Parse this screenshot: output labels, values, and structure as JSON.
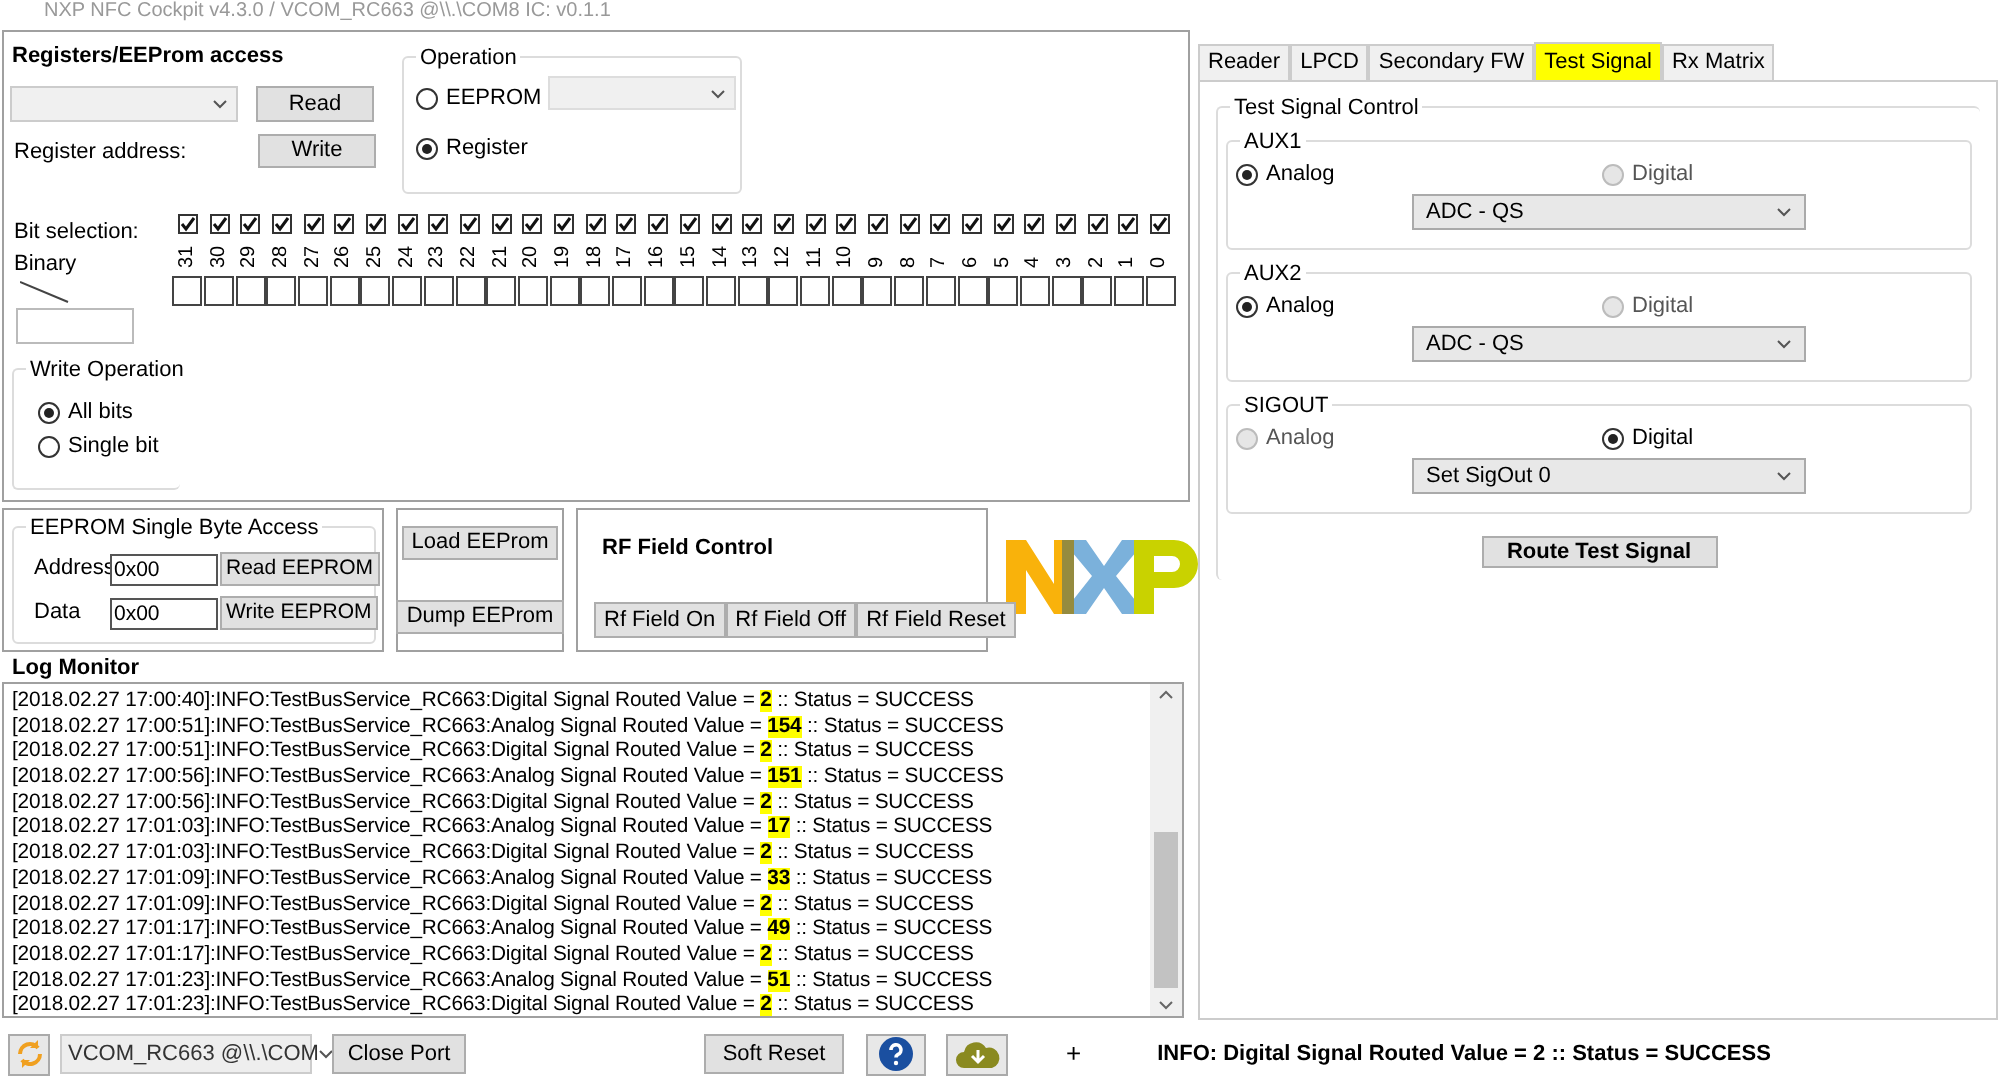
{
  "window": {
    "title": "NXP NFC Cockpit v4.3.0 / VCOM_RC663 @\\\\.\\COM8 IC: v0.1.1"
  },
  "registers": {
    "title": "Registers/EEProm access",
    "read_button": "Read",
    "write_button": "Write",
    "address_label": "Register address:",
    "operation": {
      "title": "Operation",
      "options": [
        {
          "label": "EEPROM",
          "selected": false
        },
        {
          "label": "Register",
          "selected": true
        }
      ]
    },
    "bit_selection_label": "Bit selection:",
    "binary_label": "Binary",
    "bits": [
      {
        "label": "31",
        "checked": true
      },
      {
        "label": "30",
        "checked": true
      },
      {
        "label": "29",
        "checked": true
      },
      {
        "label": "28",
        "checked": true
      },
      {
        "label": "27",
        "checked": true
      },
      {
        "label": "26",
        "checked": true
      },
      {
        "label": "25",
        "checked": true
      },
      {
        "label": "24",
        "checked": true
      },
      {
        "label": "23",
        "checked": true
      },
      {
        "label": "22",
        "checked": true
      },
      {
        "label": "21",
        "checked": true
      },
      {
        "label": "20",
        "checked": true
      },
      {
        "label": "19",
        "checked": true
      },
      {
        "label": "18",
        "checked": true
      },
      {
        "label": "17",
        "checked": true
      },
      {
        "label": "16",
        "checked": true
      },
      {
        "label": "15",
        "checked": true
      },
      {
        "label": "14",
        "checked": true
      },
      {
        "label": "13",
        "checked": true
      },
      {
        "label": "12",
        "checked": true
      },
      {
        "label": "11",
        "checked": true
      },
      {
        "label": "10",
        "checked": true
      },
      {
        "label": "9",
        "checked": true
      },
      {
        "label": "8",
        "checked": true
      },
      {
        "label": "7",
        "checked": true
      },
      {
        "label": "6",
        "checked": true
      },
      {
        "label": "5",
        "checked": true
      },
      {
        "label": "4",
        "checked": true
      },
      {
        "label": "3",
        "checked": true
      },
      {
        "label": "2",
        "checked": true
      },
      {
        "label": "1",
        "checked": true
      },
      {
        "label": "0",
        "checked": true
      }
    ],
    "write_operation": {
      "title": "Write Operation",
      "options": [
        {
          "label": "All bits",
          "selected": true
        },
        {
          "label": "Single bit",
          "selected": false
        }
      ]
    }
  },
  "eeprom_single": {
    "title": "EEPROM Single Byte Access",
    "address_label": "Address",
    "address_value": "0x00",
    "read_button": "Read EEPROM",
    "data_label": "Data",
    "data_value": "0x00",
    "write_button": "Write EEPROM"
  },
  "eeprom_buttons": [
    "Load EEProm",
    "Dump EEProm"
  ],
  "rf_field": {
    "title": "RF Field Control",
    "buttons": [
      "Rf Field On",
      "Rf Field Off",
      "Rf Field Reset"
    ]
  },
  "log": {
    "title": "Log Monitor",
    "lines": [
      {
        "before": "[2018.02.27 17:00:40]:INFO:TestBusService_RC663:Digital Signal Routed Value = ",
        "value": "2",
        "after": " :: Status = SUCCESS",
        "highlighted": true
      },
      {
        "before": "[2018.02.27 17:00:51]:INFO:TestBusService_RC663:Analog Signal Routed Value = ",
        "value": "154",
        "after": " :: Status = SUCCESS",
        "highlighted": true
      },
      {
        "before": "[2018.02.27 17:00:51]:INFO:TestBusService_RC663:Digital Signal Routed Value = ",
        "value": "2",
        "after": " :: Status = SUCCESS",
        "highlighted": true
      },
      {
        "before": "[2018.02.27 17:00:56]:INFO:TestBusService_RC663:Analog Signal Routed Value = ",
        "value": "151",
        "after": " :: Status = SUCCESS",
        "highlighted": true
      },
      {
        "before": "[2018.02.27 17:00:56]:INFO:TestBusService_RC663:Digital Signal Routed Value = ",
        "value": "2",
        "after": " :: Status = SUCCESS",
        "highlighted": true
      },
      {
        "before": "[2018.02.27 17:01:03]:INFO:TestBusService_RC663:Analog Signal Routed Value = ",
        "value": "17",
        "after": " :: Status = SUCCESS",
        "highlighted": true
      },
      {
        "before": "[2018.02.27 17:01:03]:INFO:TestBusService_RC663:Digital Signal Routed Value = ",
        "value": "2",
        "after": " :: Status = SUCCESS",
        "highlighted": true
      },
      {
        "before": "[2018.02.27 17:01:09]:INFO:TestBusService_RC663:Analog Signal Routed Value = ",
        "value": "33",
        "after": " :: Status = SUCCESS",
        "highlighted": true
      },
      {
        "before": "[2018.02.27 17:01:09]:INFO:TestBusService_RC663:Digital Signal Routed Value = ",
        "value": "2",
        "after": " :: Status = SUCCESS",
        "highlighted": true
      },
      {
        "before": "[2018.02.27 17:01:17]:INFO:TestBusService_RC663:Analog Signal Routed Value = ",
        "value": "49",
        "after": " :: Status = SUCCESS",
        "highlighted": true
      },
      {
        "before": "[2018.02.27 17:01:17]:INFO:TestBusService_RC663:Digital Signal Routed Value = ",
        "value": "2",
        "after": " :: Status = SUCCESS",
        "highlighted": true
      },
      {
        "before": "[2018.02.27 17:01:23]:INFO:TestBusService_RC663:Analog Signal Routed Value = ",
        "value": "51",
        "after": " :: Status = SUCCESS",
        "highlighted": true
      },
      {
        "before": "[2018.02.27 17:01:23]:INFO:TestBusService_RC663:Digital Signal Routed Value = ",
        "value": "2",
        "after": " :: Status = SUCCESS",
        "highlighted": true
      }
    ]
  },
  "tabs": [
    {
      "label": "Reader",
      "selected": false
    },
    {
      "label": "LPCD",
      "selected": false
    },
    {
      "label": "Secondary FW",
      "selected": false
    },
    {
      "label": "Test Signal",
      "selected": true
    },
    {
      "label": "Rx Matrix",
      "selected": false
    }
  ],
  "test_signal": {
    "title": "Test Signal Control",
    "groups": [
      {
        "title": "AUX1",
        "options": [
          {
            "label": "Analog",
            "selected": true,
            "disabled": false
          },
          {
            "label": "Digital",
            "selected": false,
            "disabled": true
          }
        ],
        "dropdown": "ADC - QS"
      },
      {
        "title": "AUX2",
        "options": [
          {
            "label": "Analog",
            "selected": true,
            "disabled": false
          },
          {
            "label": "Digital",
            "selected": false,
            "disabled": true
          }
        ],
        "dropdown": "ADC - QS"
      },
      {
        "title": "SIGOUT",
        "options": [
          {
            "label": "Analog",
            "selected": false,
            "disabled": true
          },
          {
            "label": "Digital",
            "selected": true,
            "disabled": false
          }
        ],
        "dropdown": "Set SigOut 0"
      }
    ],
    "route_button": "Route Test Signal"
  },
  "status_bar": {
    "port": "VCOM_RC663 @\\\\.\\COM",
    "close_button": "Close Port",
    "soft_reset_button": "Soft Reset",
    "plus": "+",
    "message": "INFO: Digital Signal Routed Value = 2 :: Status = SUCCESS"
  }
}
